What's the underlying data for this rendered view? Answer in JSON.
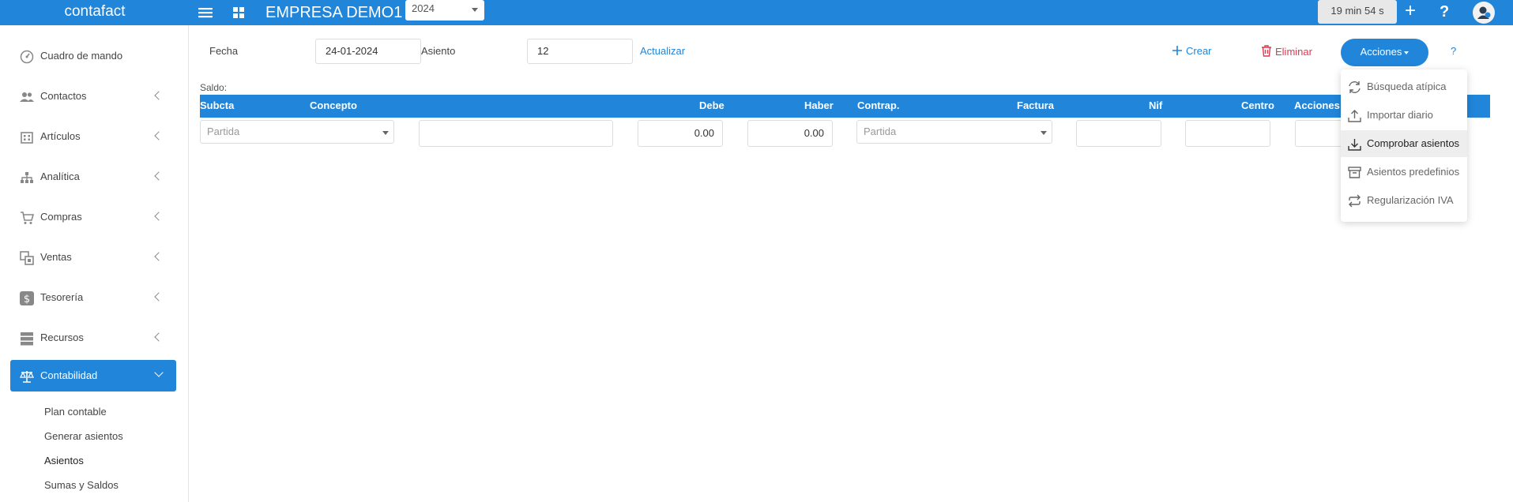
{
  "app": {
    "brand": "contafact",
    "company": "EMPRESA DEMO1",
    "year": "2024",
    "timer": "19 min 54 s",
    "plus": "+",
    "help": "?"
  },
  "sidebar": {
    "items": [
      {
        "label": "Cuadro de mando",
        "icon": "dashboard-icon"
      },
      {
        "label": "Contactos",
        "icon": "people-icon"
      },
      {
        "label": "Artículos",
        "icon": "building-icon"
      },
      {
        "label": "Analítica",
        "icon": "hierarchy-icon"
      },
      {
        "label": "Compras",
        "icon": "cart-icon"
      },
      {
        "label": "Ventas",
        "icon": "ventas-icon"
      },
      {
        "label": "Tesorería",
        "icon": "dollar-icon"
      },
      {
        "label": "Recursos",
        "icon": "server-icon"
      },
      {
        "label": "Contabilidad",
        "icon": "scale-icon"
      }
    ],
    "subitems": [
      "Plan contable",
      "Generar asientos",
      "Asientos",
      "Sumas y Saldos"
    ]
  },
  "form": {
    "fecha_label": "Fecha",
    "fecha_value": "24-01-2024",
    "asiento_label": "Asiento",
    "asiento_value": "12",
    "actualizar": "Actualizar",
    "crear": "Crear",
    "eliminar": "Eliminar",
    "acciones": "Acciones",
    "help": "?"
  },
  "table": {
    "saldo": "Saldo:",
    "headers": [
      "Subcta",
      "Concepto",
      "Debe",
      "Haber",
      "Contrap.",
      "Factura",
      "Nif",
      "Centro",
      "Acciones"
    ],
    "row": {
      "subcta_placeholder": "Partida",
      "debe": "0.00",
      "haber": "0.00",
      "contrap_placeholder": "Partida"
    }
  },
  "menu": {
    "items": [
      {
        "label": "Búsqueda atípica",
        "icon": "refresh-icon"
      },
      {
        "label": "Importar diario",
        "icon": "upload-icon"
      },
      {
        "label": "Comprobar asientos",
        "icon": "download-icon",
        "highlighted": true
      },
      {
        "label": "Asientos predefinios",
        "icon": "archive-icon"
      },
      {
        "label": "Regularización IVA",
        "icon": "repeat-icon"
      }
    ]
  },
  "colors": {
    "primary": "#2185d9",
    "danger": "#e0384f"
  }
}
